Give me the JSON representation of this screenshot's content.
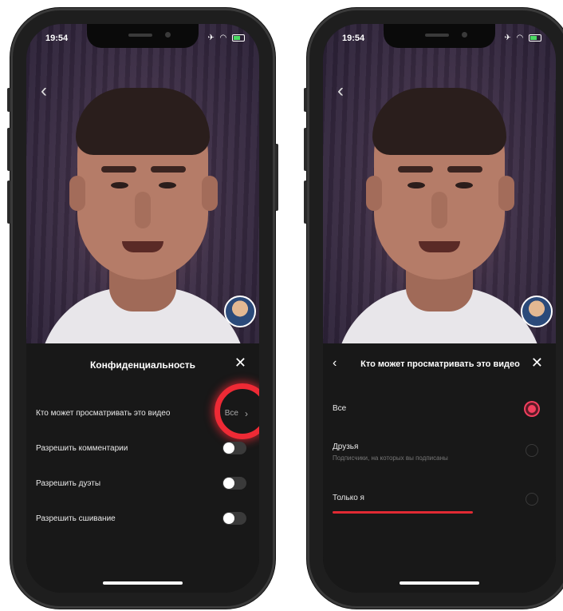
{
  "left_phone": {
    "status_time": "19:54",
    "sheet": {
      "title": "Конфиденциальность",
      "close_icon": "close-icon",
      "rows": [
        {
          "label": "Кто может просматривать это видео",
          "value": "Все"
        },
        {
          "label": "Разрешить комментарии"
        },
        {
          "label": "Разрешить дуэты"
        },
        {
          "label": "Разрешить сшивание"
        }
      ]
    }
  },
  "right_phone": {
    "status_time": "19:54",
    "sheet": {
      "title": "Кто может просматривать это видео",
      "options": [
        {
          "label": "Все",
          "selected": true
        },
        {
          "label": "Друзья",
          "sublabel": "Подписчики, на которых вы подписаны",
          "selected": false
        },
        {
          "label": "Только я",
          "selected": false
        }
      ]
    }
  },
  "colors": {
    "accent": "#f23f5e",
    "highlight_ring": "#ee2a35",
    "sheet_bg": "#181818"
  }
}
